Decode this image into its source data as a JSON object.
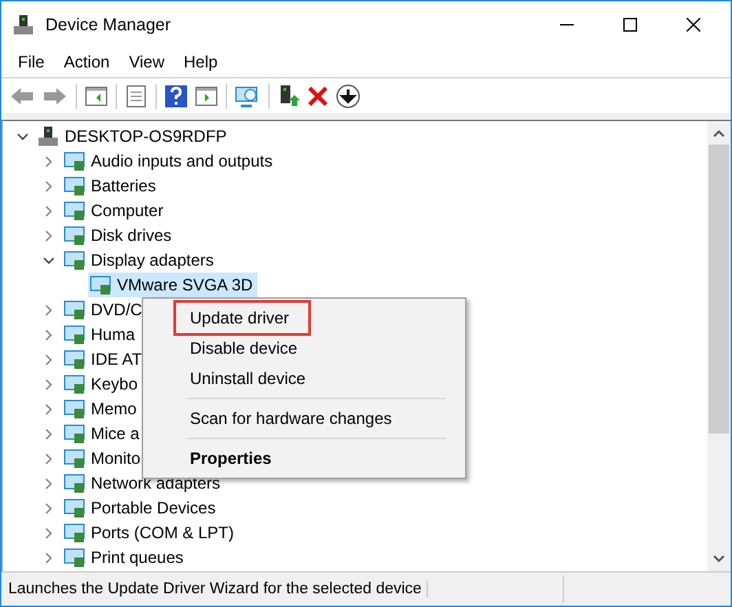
{
  "window": {
    "title": "Device Manager"
  },
  "menu_bar": [
    "File",
    "Action",
    "View",
    "Help"
  ],
  "tree": [
    {
      "label": "DESKTOP-OS9RDFP",
      "expanded": true,
      "selected": false,
      "children": [
        {
          "label": "Audio inputs and outputs",
          "expanded": false,
          "selected": false
        },
        {
          "label": "Batteries",
          "expanded": false,
          "selected": false
        },
        {
          "label": "Computer",
          "expanded": false,
          "selected": false
        },
        {
          "label": "Disk drives",
          "expanded": false,
          "selected": false
        },
        {
          "label": "Display adapters",
          "expanded": true,
          "selected": false,
          "children": [
            {
              "label": "VMware SVGA 3D",
              "selected": true
            }
          ]
        },
        {
          "label": "DVD/C",
          "expanded": false,
          "selected": false
        },
        {
          "label": "Huma",
          "expanded": false,
          "selected": false
        },
        {
          "label": "IDE AT",
          "expanded": false,
          "selected": false
        },
        {
          "label": "Keybo",
          "expanded": false,
          "selected": false
        },
        {
          "label": "Memo",
          "expanded": false,
          "selected": false
        },
        {
          "label": "Mice a",
          "expanded": false,
          "selected": false
        },
        {
          "label": "Monito",
          "expanded": false,
          "selected": false
        },
        {
          "label": "Network adapters",
          "expanded": false,
          "selected": false
        },
        {
          "label": "Portable Devices",
          "expanded": false,
          "selected": false
        },
        {
          "label": "Ports (COM & LPT)",
          "expanded": false,
          "selected": false
        },
        {
          "label": "Print queues",
          "expanded": false,
          "selected": false
        }
      ]
    }
  ],
  "context_menu": [
    {
      "label": "Update driver",
      "highlighted": true,
      "bold": false,
      "separator_before": false
    },
    {
      "label": "Disable device",
      "highlighted": false,
      "bold": false,
      "separator_before": false
    },
    {
      "label": "Uninstall device",
      "highlighted": false,
      "bold": false,
      "separator_before": false
    },
    {
      "label": "Scan for hardware changes",
      "highlighted": false,
      "bold": false,
      "separator_before": true
    },
    {
      "label": "Properties",
      "highlighted": false,
      "bold": true,
      "separator_before": true
    }
  ],
  "status_bar": "Launches the Update Driver Wizard for the selected device"
}
